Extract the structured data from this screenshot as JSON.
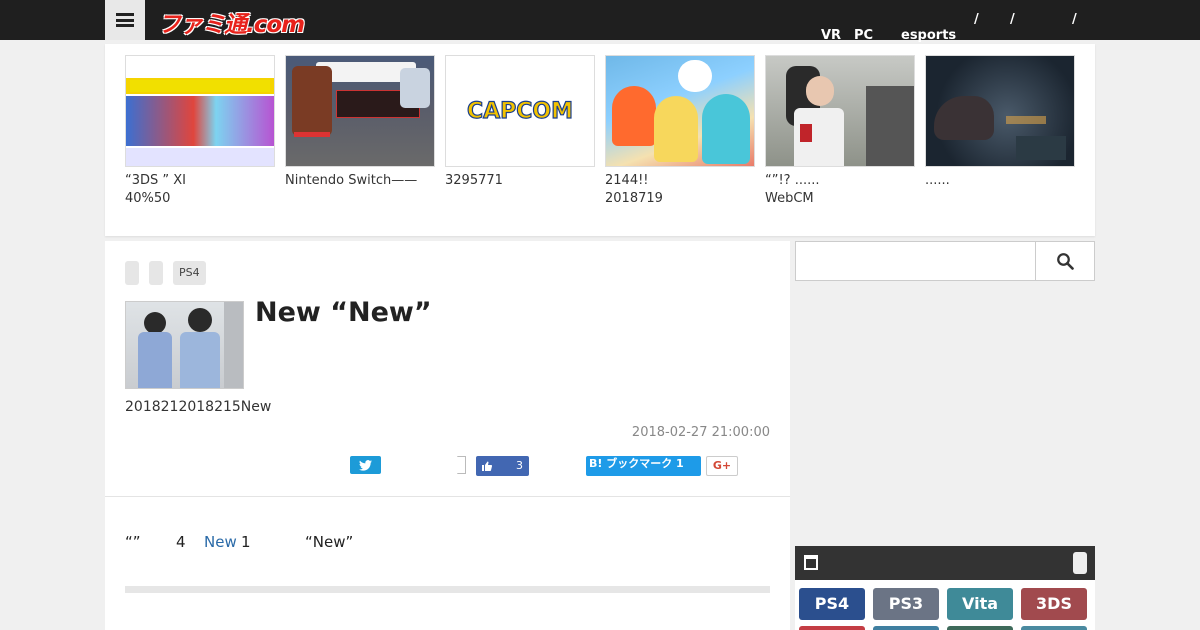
{
  "header": {
    "logo_text": "ファミ通.com",
    "nav": [
      {
        "label": "VR"
      },
      {
        "label": "PC"
      },
      {
        "label": "esports"
      },
      {
        "label": "/"
      },
      {
        "label": "/"
      },
      {
        "label": "/"
      }
    ]
  },
  "carousel": [
    {
      "line1": "“3DS ” XI",
      "line2": "40%50",
      "image": "nintendo-sale-banner"
    },
    {
      "line1": "Nintendo Switch——",
      "line2": "",
      "image": "game-dialogue-screenshot"
    },
    {
      "line1": "3295771",
      "line2": "",
      "image": "capcom-logo",
      "logo_text": "CAPCOM"
    },
    {
      "line1": "2144!!",
      "line2": "2018719",
      "image": "anime-characters-art"
    },
    {
      "line1": "“”!? ......",
      "line2": "WebCM",
      "image": "cosplay-photo"
    },
    {
      "line1": "......",
      "line2": "",
      "image": "dark-monster-scene"
    }
  ],
  "article": {
    "tags": [
      "",
      "",
      "PS4"
    ],
    "headline": "New “New”",
    "subline": "2018212018215New",
    "date": "2018-02-27 21:00:00",
    "like_count": "3",
    "hatena_label": "B! ブックマーク 1",
    "gplus_label": "G+",
    "lead": {
      "part1": "“”",
      "part2": "4",
      "link": "New",
      "part3": "1",
      "part4": "“New”"
    }
  },
  "sidebar": {
    "search_placeholder": "",
    "platforms": [
      {
        "label": "PS4",
        "color": "#2b4f8e"
      },
      {
        "label": "PS3",
        "color": "#6b7485"
      },
      {
        "label": "Vita",
        "color": "#3f8a98"
      },
      {
        "label": "3DS",
        "color": "#a14a4e"
      }
    ]
  },
  "colors": {
    "accent_red": "#e8221b",
    "topbar": "#1f1f1f",
    "twitter": "#1d9bd8",
    "facebook": "#3b5998",
    "hatena": "#1e9be8"
  }
}
